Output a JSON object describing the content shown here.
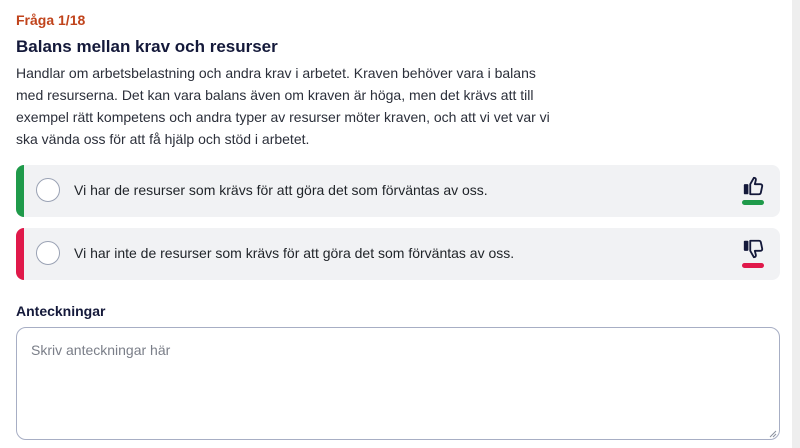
{
  "question": {
    "counter": "Fråga 1/18",
    "title": "Balans mellan krav och resurser",
    "description": "Handlar om arbetsbelastning och andra krav i arbetet. Kraven behöver vara i balans med resurserna. Det kan vara balans även om kraven är höga, men det krävs att till exempel rätt kompetens och andra typer av resurser möter kraven, och att vi vet var vi ska vända oss för att få hjälp och stöd i arbetet."
  },
  "options": [
    {
      "label": "Vi har de resurser som krävs för att göra det som förväntas av oss.",
      "icon": "thumbs-up-icon",
      "accent": "#1f9a4a",
      "selected": false
    },
    {
      "label": "Vi har inte de resurser som krävs för att göra det som förväntas av oss.",
      "icon": "thumbs-down-icon",
      "accent": "#e0194a",
      "selected": false
    }
  ],
  "notes": {
    "label": "Anteckningar",
    "placeholder": "Skriv anteckningar här",
    "value": ""
  },
  "colors": {
    "counter": "#c0431b",
    "heading": "#14193a",
    "positive": "#1f9a4a",
    "negative": "#e0194a",
    "option_bg": "#f1f2f4"
  }
}
